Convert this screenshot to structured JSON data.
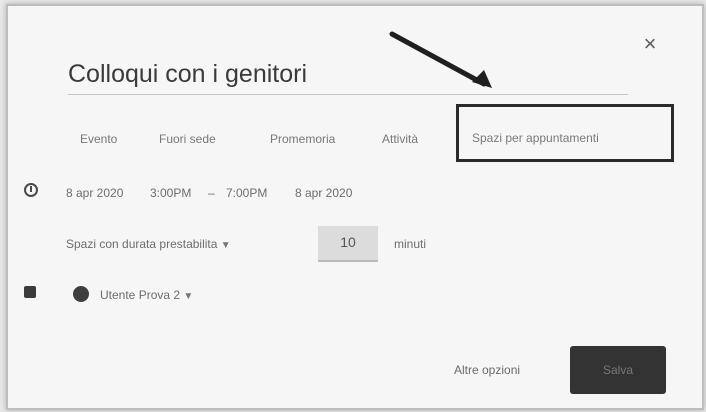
{
  "dialog": {
    "title": "Colloqui con i genitori",
    "close_symbol": "×"
  },
  "tabs": [
    {
      "label": "Evento"
    },
    {
      "label": "Fuori sede"
    },
    {
      "label": "Promemoria"
    },
    {
      "label": "Attività"
    },
    {
      "label": "Spazi per appuntamenti"
    }
  ],
  "schedule": {
    "start_date": "8 apr 2020",
    "start_time": "3:00PM",
    "separator": "–",
    "end_time": "7:00PM",
    "end_date": "8 apr 2020"
  },
  "slots": {
    "mode_label": "Spazi con durata prestabilita",
    "duration_value": "10",
    "unit": "minuti"
  },
  "calendar": {
    "owner": "Utente Prova 2"
  },
  "footer": {
    "more_options": "Altre opzioni",
    "save": "Salva"
  },
  "colors": {
    "highlight_box": "#2b2b2b"
  },
  "icons": {
    "close": "close-icon",
    "time": "clock-icon",
    "calendar": "calendar-icon",
    "dropdown": "chevron-down-icon"
  }
}
